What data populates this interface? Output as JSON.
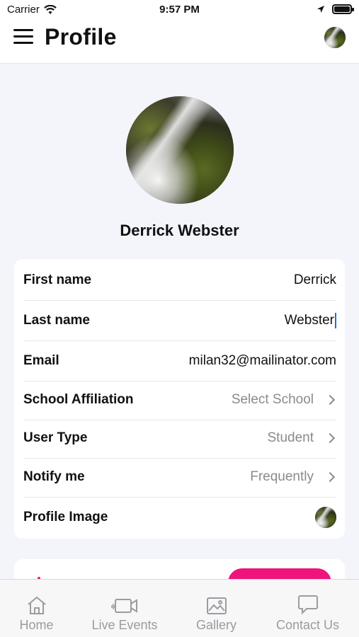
{
  "status_bar": {
    "carrier": "Carrier",
    "time": "9:57 PM"
  },
  "header": {
    "title": "Profile"
  },
  "profile": {
    "name": "Derrick Webster"
  },
  "details": [
    {
      "label": "First name",
      "value": "Derrick"
    },
    {
      "label": "Last name",
      "value": "Webster"
    },
    {
      "label": "Email",
      "value": "milan32@mailinator.com"
    },
    {
      "label": "School Affiliation",
      "value": "Select School"
    },
    {
      "label": "User Type",
      "value": "Student"
    },
    {
      "label": "Notify me",
      "value": "Frequently"
    },
    {
      "label": "Profile Image",
      "value": ""
    }
  ],
  "tabs": [
    {
      "label": "Home",
      "icon": "home-icon"
    },
    {
      "label": "Live Events",
      "icon": "video-camera-icon"
    },
    {
      "label": "Gallery",
      "icon": "image-icon"
    },
    {
      "label": "Contact Us",
      "icon": "chat-bubble-icon"
    }
  ],
  "colors": {
    "accent": "#f0137c",
    "background": "#f3f5fa",
    "muted": "#8a8a8f",
    "cursor": "#1b6ff1"
  }
}
